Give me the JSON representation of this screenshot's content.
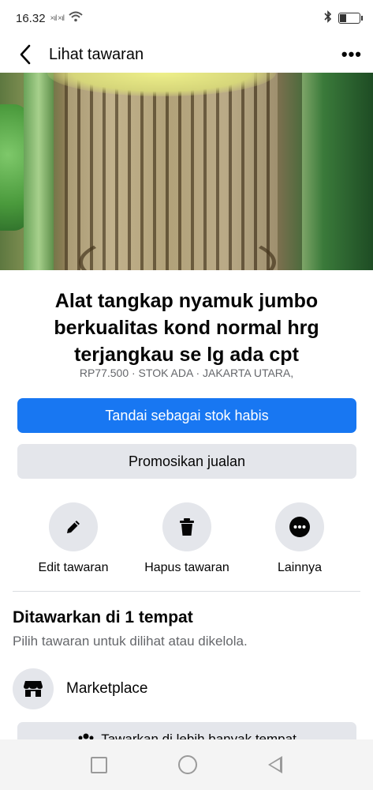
{
  "status_bar": {
    "time": "16.32",
    "signal_text": "×ıl ×ıl"
  },
  "header": {
    "title": "Lihat tawaran",
    "more_label": "•••"
  },
  "listing": {
    "image_count": 8,
    "active_image_index": 0,
    "title": "Alat tangkap nyamuk jumbo berkualitas kond normal hrg terjangkau se lg ada cpt",
    "meta": "RP77.500 · STOK ADA · JAKARTA UTARA,"
  },
  "buttons": {
    "mark_sold": "Tandai sebagai stok habis",
    "promote": "Promosikan jualan"
  },
  "actions": [
    {
      "label": "Edit tawaran",
      "icon": "pencil-icon"
    },
    {
      "label": "Hapus tawaran",
      "icon": "trash-icon"
    },
    {
      "label": "Lainnya",
      "icon": "more-icon"
    }
  ],
  "offered_in": {
    "title": "Ditawarkan di 1 tempat",
    "subtitle": "Pilih tawaran untuk dilihat atau dikelola.",
    "places": [
      {
        "label": "Marketplace",
        "icon": "marketplace-store-icon"
      }
    ],
    "more_button": "Tawarkan di lebih banyak tempat"
  },
  "colors": {
    "primary": "#1877f2",
    "secondary_bg": "#e4e6eb",
    "muted_text": "#65676b"
  }
}
